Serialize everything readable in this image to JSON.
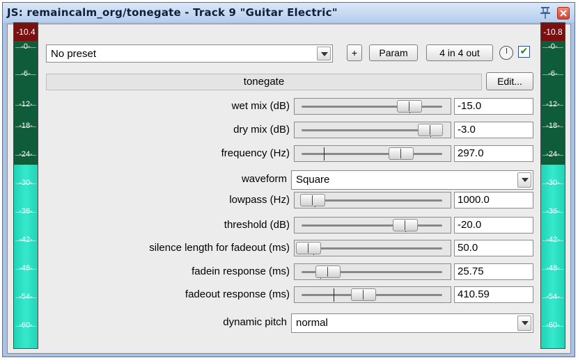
{
  "window": {
    "title": "JS: remaincalm_org/tonegate - Track 9 \"Guitar Electric\""
  },
  "toolbar": {
    "preset_value": "No preset",
    "plus_label": "+",
    "param_label": "Param",
    "io_label": "4 in 4 out",
    "enabled_check": "✔"
  },
  "meters": {
    "left_peak": "-10.4",
    "right_peak": "-10.8",
    "scale": [
      "-0-",
      "-6-",
      "-12-",
      "-18-",
      "-24-",
      "-30-",
      "-36-",
      "-42-",
      "-48-",
      "-54-",
      "-60-"
    ]
  },
  "plugin": {
    "name": "tonegate",
    "edit_label": "Edit..."
  },
  "params": [
    {
      "label": "wet mix (dB)",
      "value": "-15.0",
      "position": 0.78,
      "default": 0.78
    },
    {
      "label": "dry mix (dB)",
      "value": "-3.0",
      "position": 0.94,
      "default": 0.94
    },
    {
      "label": "frequency (Hz)",
      "value": "297.0",
      "position": 0.72,
      "default": 0.13
    },
    {
      "label": "lowpass (Hz)",
      "value": "1000.0",
      "position": 0.04,
      "default": 0.06
    },
    {
      "label": "threshold (dB)",
      "value": "-20.0",
      "position": 0.75,
      "default": 0.75
    },
    {
      "label": "silence length for fadeout (ms)",
      "value": "50.0",
      "position": 0.01,
      "default": 0.05
    },
    {
      "label": "fadein response (ms)",
      "value": "25.75",
      "position": 0.16,
      "default": 0.1
    },
    {
      "label": "fadeout response (ms)",
      "value": "410.59",
      "position": 0.43,
      "default": 0.2
    }
  ],
  "waveform": {
    "label": "waveform",
    "value": "Square"
  },
  "dynamic_pitch": {
    "label": "dynamic pitch",
    "value": "normal"
  },
  "colors": {
    "meter_green": "#0f5c3a",
    "meter_cyan": "#2fdcc0",
    "meter_peak": "#7b1010"
  }
}
